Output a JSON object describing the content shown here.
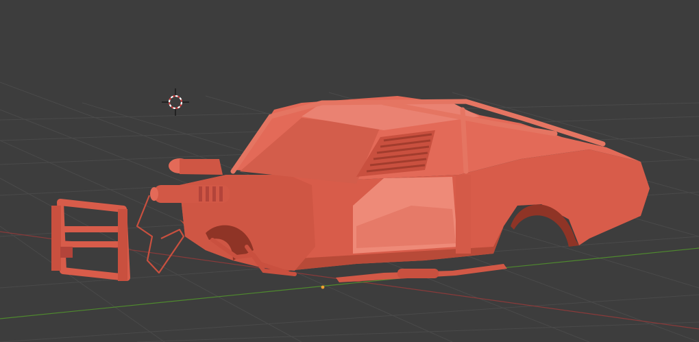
{
  "viewport": {
    "background_color": "#3d3d3d",
    "grid_color": "#4a4a4a",
    "x_axis_color": "#8a3a3a",
    "y_axis_color": "#4f8a2e"
  },
  "object": {
    "kind": "car-body-mesh",
    "material_color": "#d85c4a",
    "shadow_color": "#a8402f",
    "highlight_color": "#ee8a78"
  },
  "cursor": {
    "icon": "3d-cursor-icon",
    "ring_color": "#ffffff",
    "ring_accent_color": "#d23b3b"
  },
  "origin": {
    "icon": "origin-dot-icon",
    "color": "#f0a030"
  }
}
